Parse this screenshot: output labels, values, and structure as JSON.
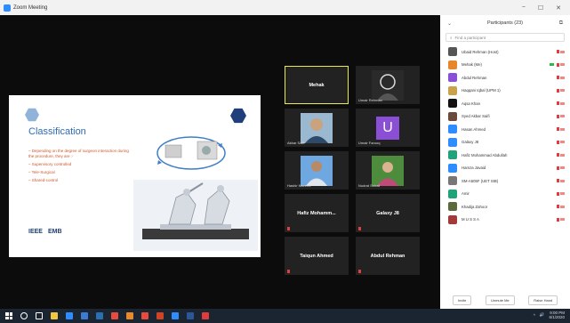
{
  "window": {
    "title": "Zoom Meeting",
    "controls": [
      "−",
      "☐",
      "✕"
    ]
  },
  "slide": {
    "title": "Classification",
    "bullets": [
      "– Depending on the degree of surgeon interaction during the procedure, they are :-",
      "– Supervisory controlled",
      "– Tele-Surgical",
      "– Shared-control"
    ],
    "logos": [
      "IEEE",
      "EMB"
    ]
  },
  "tiles": [
    {
      "label": "Mehak",
      "kind": "text",
      "active": true
    },
    {
      "label": "Umair Rehman",
      "kind": "photo"
    },
    {
      "label": "Akbar Saifi",
      "kind": "photo"
    },
    {
      "label": "Umair Farooq",
      "kind": "letter",
      "letter": "U"
    },
    {
      "label": "Hashir Naveed",
      "kind": "photo"
    },
    {
      "label": "Nudrat Sohail",
      "kind": "photo"
    },
    {
      "label": "Hafiz Mohamm...",
      "kind": "text"
    },
    {
      "label": "Galaxy J8",
      "kind": "text"
    },
    {
      "label": "Taiqun Ahmed",
      "kind": "text"
    },
    {
      "label": "Abdul Rehman",
      "kind": "text"
    }
  ],
  "panel": {
    "title": "Participants (23)",
    "search_placeholder": "Find a participant",
    "participants": [
      {
        "name": "Ubaid Rehman (Host)",
        "color": "#555555",
        "video": false
      },
      {
        "name": "Mehak (Me)",
        "color": "#e8862c",
        "video": true
      },
      {
        "name": "Abdul Rehman",
        "color": "#8a4fd4",
        "video": false
      },
      {
        "name": "Haqqani Iqbal (UPM 1)",
        "color": "#c9a24a",
        "video": false
      },
      {
        "name": "Aqsa Khan",
        "color": "#111111",
        "video": false
      },
      {
        "name": "Syed Akbar Saifi",
        "color": "#6a4a3a",
        "video": false
      },
      {
        "name": "Hasan Ahmed",
        "color": "#2d8cff",
        "video": false
      },
      {
        "name": "Galaxy J8",
        "color": "#2d8cff",
        "video": false
      },
      {
        "name": "Hafiz Mohammad Abdullah",
        "color": "#1fa37a",
        "video": false
      },
      {
        "name": "Hamza Javaid",
        "color": "#2d8cff",
        "video": false
      },
      {
        "name": "SM-A505F (UET ISB)",
        "color": "#777777",
        "video": false
      },
      {
        "name": "Amir",
        "color": "#1fa37a",
        "video": false
      },
      {
        "name": "Khadija Zahoor",
        "color": "#5a6a3a",
        "video": false
      },
      {
        "name": "M U S S A",
        "color": "#a33a3a",
        "video": false
      }
    ],
    "footer": [
      "Invite",
      "Unmute Me",
      "Raise Hand"
    ]
  },
  "taskbar": {
    "icons": [
      "windows-icon",
      "search-icon",
      "task-view-icon",
      "file-explorer-icon",
      "store-icon",
      "mail-icon",
      "photoshop-icon",
      "chrome-icon",
      "illustrator-icon",
      "office-icon",
      "powerpoint-icon",
      "zoom-icon",
      "word-icon",
      "edge-icon"
    ],
    "colors": [
      "#ffffff",
      "#ffffff",
      "#ffffff",
      "#f4c542",
      "#2d8cff",
      "#3a7bd5",
      "#2a6fb0",
      "#e84a3c",
      "#e88a2c",
      "#e84a3c",
      "#d04423",
      "#2d8cff",
      "#2b579a",
      "#e23b3b"
    ],
    "clock_time": "9:00 PM",
    "clock_date": "6/1/2020"
  }
}
